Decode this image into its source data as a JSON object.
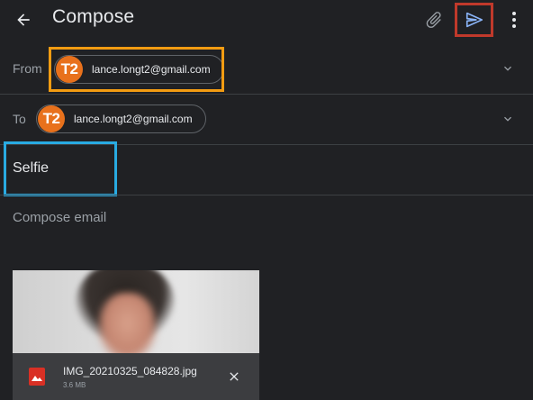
{
  "header": {
    "title": "Compose",
    "icons": {
      "back": "arrow-back-icon",
      "attach": "paperclip-icon",
      "send": "send-icon",
      "more": "more-vert-icon"
    }
  },
  "from": {
    "label": "From",
    "avatar_initials": "T2",
    "email": "lance.longt2@gmail.com"
  },
  "to": {
    "label": "To",
    "avatar_initials": "T2",
    "email": "lance.longt2@gmail.com"
  },
  "subject": {
    "value": "Selfie"
  },
  "body": {
    "placeholder": "Compose email"
  },
  "attachment": {
    "file_name": "IMG_20210325_084828.jpg",
    "file_size": "3.6 MB"
  },
  "colors": {
    "background": "#202124",
    "avatar": "#e8711c",
    "send_icon": "#8ab4f8",
    "file_icon": "#d93025",
    "highlight_orange": "#f39c12",
    "highlight_blue": "#29abe2",
    "highlight_red": "#c0392b"
  }
}
